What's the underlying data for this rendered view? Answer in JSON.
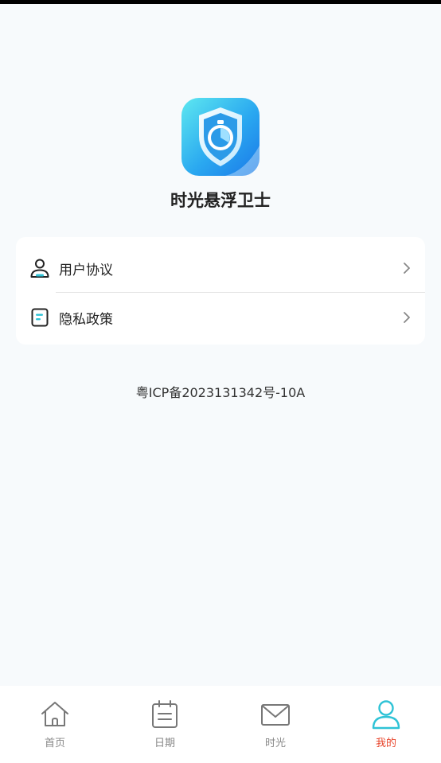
{
  "app": {
    "name": "时光悬浮卫士"
  },
  "menu": {
    "items": [
      {
        "label": "用户协议",
        "icon": "user-icon"
      },
      {
        "label": "隐私政策",
        "icon": "document-icon"
      }
    ]
  },
  "footer": {
    "icp": "粤ICP备2023131342号-10A"
  },
  "tabs": [
    {
      "label": "首页",
      "icon": "home-icon",
      "active": false
    },
    {
      "label": "日期",
      "icon": "calendar-icon",
      "active": false
    },
    {
      "label": "时光",
      "icon": "mail-icon",
      "active": false
    },
    {
      "label": "我的",
      "icon": "profile-icon",
      "active": true
    }
  ],
  "colors": {
    "accent": "#2fc3d6",
    "active_label": "#e8452c",
    "inactive": "#888888",
    "background": "#f7fafc"
  }
}
